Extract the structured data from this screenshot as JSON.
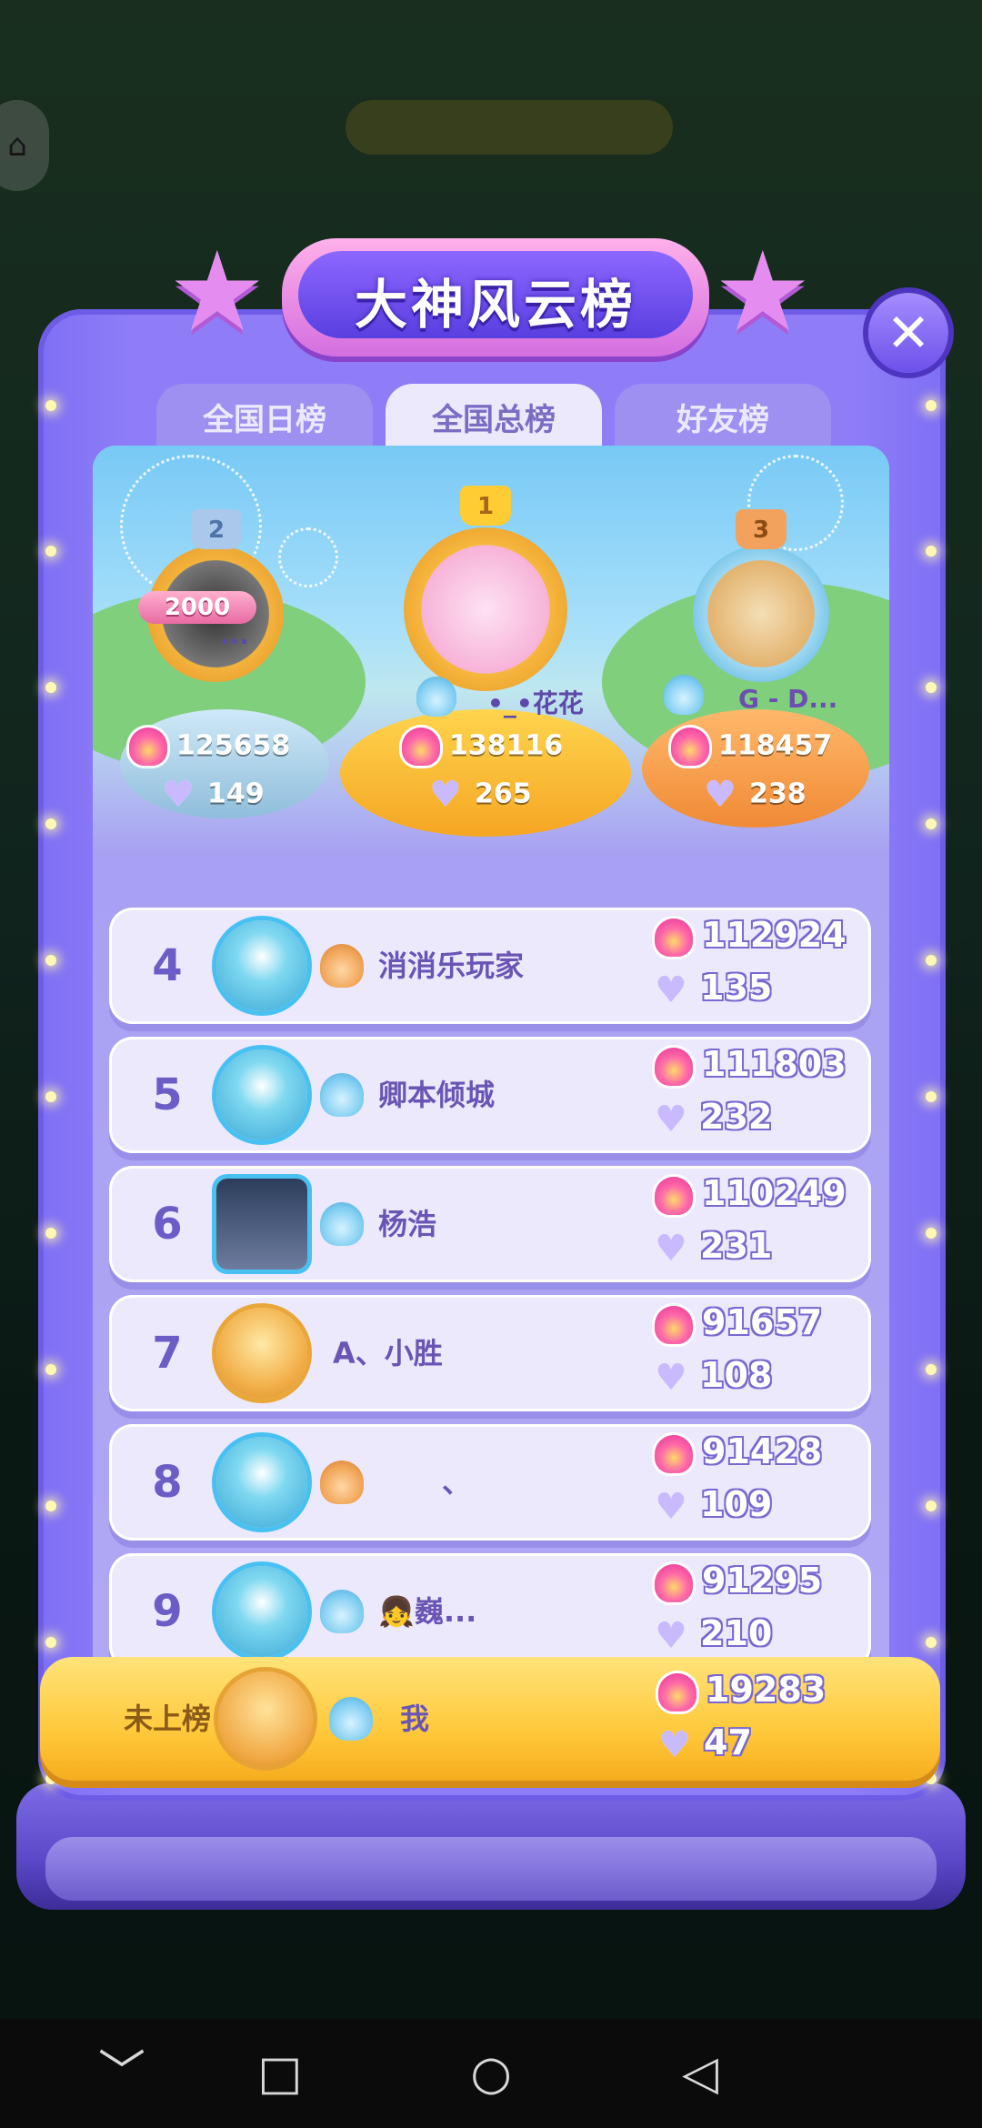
{
  "title": "大神风云榜",
  "close_label": "✕",
  "tabs": [
    {
      "label": "全国日榜"
    },
    {
      "label": "全国总榜"
    },
    {
      "label": "好友榜"
    }
  ],
  "active_tab": "全国总榜",
  "podium": {
    "first": {
      "rank": "1",
      "name": "•_•花花",
      "score": "138116",
      "hearts": "265"
    },
    "second": {
      "rank": "2",
      "name": "...",
      "badge": "2000",
      "score": "125658",
      "hearts": "149"
    },
    "third": {
      "rank": "3",
      "name": "G - D...",
      "score": "118457",
      "hearts": "238"
    }
  },
  "rows": [
    {
      "rank": "4",
      "name": "消消乐玩家",
      "score": "112924",
      "hearts": "135",
      "level_color": "orange"
    },
    {
      "rank": "5",
      "name": "卿本倾城",
      "score": "111803",
      "hearts": "232",
      "level_color": "blue"
    },
    {
      "rank": "6",
      "name": "杨浩",
      "score": "110249",
      "hearts": "231",
      "level_color": "blue"
    },
    {
      "rank": "7",
      "name": "A、小胜",
      "score": "91657",
      "hearts": "108",
      "level_color": "none"
    },
    {
      "rank": "8",
      "name": "、",
      "score": "91428",
      "hearts": "109",
      "level_color": "orange"
    },
    {
      "rank": "9",
      "name": "👧巍...",
      "score": "91295",
      "hearts": "210",
      "level_color": "blue"
    }
  ],
  "me": {
    "status": "未上榜",
    "name": "我",
    "score": "19283",
    "hearts": "47"
  },
  "navbar": {
    "back": "﹀",
    "recent": "□",
    "home": "○",
    "triangle": "◁"
  },
  "colors": {
    "panel": "#8e7df7",
    "gold": "#ffc93b",
    "accent": "#6b5cc6"
  }
}
